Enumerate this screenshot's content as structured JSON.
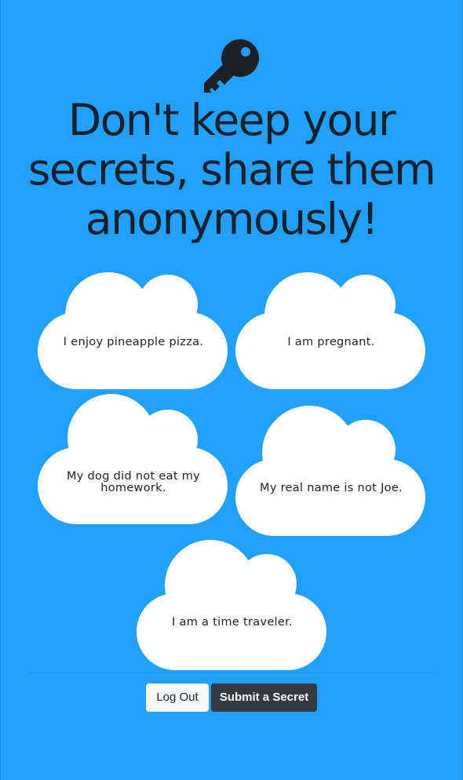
{
  "page": {
    "headline": "Don't keep your secrets, share them anonymously!",
    "background_color": "#22a0fc",
    "icon": "key-icon"
  },
  "secrets": [
    {
      "text": "I enjoy pineapple pizza."
    },
    {
      "text": "I am pregnant."
    },
    {
      "text": "My dog did not eat my homework."
    },
    {
      "text": "My real name is not Joe."
    },
    {
      "text": "I am a time traveler."
    }
  ],
  "actions": {
    "logout_label": "Log Out",
    "submit_label": "Submit a Secret"
  }
}
